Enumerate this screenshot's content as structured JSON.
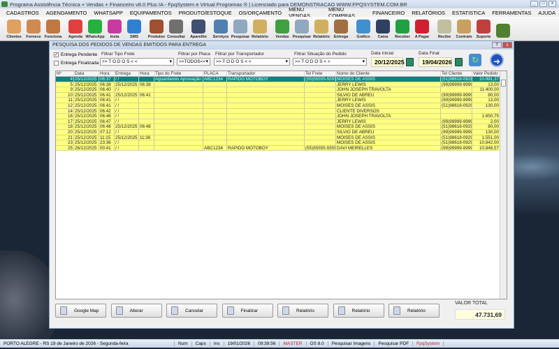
{
  "window": {
    "title": "Programa Assistência Técnica + Vendas + Financeiro v8.0 Plus IA - FpqSystem e Virtual Programas ® | Licenciado para  DEMONSTRACAO WWW.FPQSYSTEM.COM.BR"
  },
  "menu": [
    "CADASTROS",
    "AGENDAMENTO",
    "WHATSAPP",
    "EQUIPAMENTOS",
    "PRODUTO/ESTOQUE",
    "OS/ORÇAMENTO",
    "MENU VENDAS",
    "MENU COMPRAS",
    "FINANCEIRO",
    "RELATÓRIOS",
    "ESTATISTICA",
    "FERRAMENTAS",
    "AJUDA"
  ],
  "toolbar": [
    {
      "label": "Clientes",
      "color": "#e0a060"
    },
    {
      "label": "Fornece",
      "color": "#d08a50"
    },
    {
      "label": "Funciona",
      "color": "#c07840"
    },
    {
      "sep": true
    },
    {
      "label": "Agenda",
      "color": "#e04040"
    },
    {
      "label": "WhatsApp",
      "color": "#25b040"
    },
    {
      "label": "Insta",
      "color": "#c83aa0"
    },
    {
      "label": "SMS",
      "color": "#2f80d0"
    },
    {
      "sep": true
    },
    {
      "label": "Produtos",
      "color": "#a05030"
    },
    {
      "label": "Consultar",
      "color": "#707070"
    },
    {
      "sep": true
    },
    {
      "label": "Aparelho",
      "color": "#405070"
    },
    {
      "sep": true
    },
    {
      "label": "Serviços",
      "color": "#5080b0"
    },
    {
      "label": "Pesquisar",
      "color": "#90a8c0"
    },
    {
      "label": "Relatório",
      "color": "#d0b060"
    },
    {
      "sep": true
    },
    {
      "label": "Vendas",
      "color": "#40a040"
    },
    {
      "label": "Pesquisar",
      "color": "#90a8c0"
    },
    {
      "label": "Relatório",
      "color": "#d0b060"
    },
    {
      "label": "Entrega",
      "color": "#a07040"
    },
    {
      "sep": true
    },
    {
      "label": "Gráfico",
      "color": "#4090d0"
    },
    {
      "label": "Caixa",
      "color": "#304060"
    },
    {
      "label": "Receber",
      "color": "#20a040"
    },
    {
      "label": "A Pagar",
      "color": "#d02030"
    },
    {
      "sep": true
    },
    {
      "label": "Recibo",
      "color": "#c0c0a0"
    },
    {
      "label": "Contrato",
      "color": "#c8a060"
    },
    {
      "label": "Suporte",
      "color": "#c04040"
    },
    {
      "label": "",
      "color": "#508030"
    }
  ],
  "dialog": {
    "title": "PESQUISA DOS PEDIDOS DE VENDAS EMITIDOS PARA ENTREGA",
    "chk_pendente": "Entrega Pendente",
    "chk_finalizada": "Entrega Finalizada",
    "f_tipo_label": "Filtrar Tipo Frete",
    "f_tipo": ">> T O D O S < <",
    "f_placa_label": "Filtrar por Placa",
    "f_placa": ">>TODOS<<",
    "f_transp_label": "Filtrar por Transportador",
    "f_transp": ">> T O D O S < <",
    "f_sit_label": "Filtrar Situação do Pedido",
    "f_sit": ">> T O D O S < <",
    "d_ini_label": "Data Inicial",
    "d_ini": "20/12/2025",
    "d_fim_label": "Data Final",
    "d_fim": "19/04/2026",
    "columns": [
      "Nº",
      "Data",
      "Hora",
      "Entrega",
      "Hora",
      "Tipo do Frete",
      "PLACA",
      "Transportador",
      "Tel Frete",
      "Nome do Cliente",
      "Tel Cliente",
      "Valor Pedido"
    ],
    "rows": [
      [
        "4",
        "25/12/2025",
        "06:37",
        " / /",
        "",
        "Aguardando Aprovação",
        "ABC1234",
        "RAPIDO MOTOBOY",
        "(55)55555-5555",
        "MOISES DE ASSIS",
        "(51)98618-0929",
        "10.991,37"
      ],
      [
        "5",
        "25/12/2025",
        "06:38",
        "25/12/2025",
        "06:38",
        "",
        "",
        "",
        "",
        "JERRY LEWIS",
        "(99)99999-9999",
        "13,00"
      ],
      [
        "9",
        "25/12/2025",
        "06:40",
        " / /",
        "",
        "",
        "",
        "",
        "",
        "JOHN JOSEPH TRAVOLTA",
        "",
        "11.400,00"
      ],
      [
        "10",
        "25/12/2025",
        "06:41",
        "25/12/2025",
        "06:41",
        "",
        "",
        "",
        "",
        "SILVIO DE ABREU",
        "(99)99999-9999",
        "80,00"
      ],
      [
        "11",
        "25/12/2025",
        "06:41",
        " / /",
        "",
        "",
        "",
        "",
        "",
        "JERRY LEWIS",
        "(99)99999-9999",
        "13,00"
      ],
      [
        "12",
        "25/12/2025",
        "06:41",
        " / /",
        "",
        "",
        "",
        "",
        "",
        "MOISES DE ASSIS",
        "(51)98618-0929",
        "130,00"
      ],
      [
        "14",
        "25/12/2025",
        "06:42",
        " / /",
        "",
        "",
        "",
        "",
        "",
        "CLIENTE DIVERSOS",
        "",
        ""
      ],
      [
        "16",
        "25/12/2025",
        "06:46",
        " / /",
        "",
        "",
        "",
        "",
        "",
        "JOHN JOSEPH TRAVOLTA",
        "",
        "1.650,75"
      ],
      [
        "17",
        "25/12/2025",
        "06:47",
        " / /",
        "",
        "",
        "",
        "",
        "",
        "JERRY LEWIS",
        "(99)99999-9999",
        "2,00"
      ],
      [
        "18",
        "25/12/2025",
        "06:48",
        "25/12/2025",
        "06:48",
        "",
        "",
        "",
        "",
        "MOISES DE ASSIS",
        "(51)98618-0929",
        "80,00"
      ],
      [
        "20",
        "25/12/2025",
        "07:12",
        " / /",
        "",
        "",
        "",
        "",
        "",
        "SILVIO DE ABREU",
        "(99)99999-9999",
        "130,00"
      ],
      [
        "21",
        "25/12/2025",
        "11:15",
        "25/12/2025",
        "11:36",
        "",
        "",
        "",
        "",
        "MOISES DE ASSIS",
        "(51)98618-0929",
        "1.551,00"
      ],
      [
        "23",
        "25/12/2025",
        "23:36",
        " / /",
        "",
        "",
        "",
        "",
        "",
        "MOISES DE ASSIS",
        "(51)98618-0929",
        "10.842,00"
      ],
      [
        "25",
        "26/12/2025",
        "00:41",
        " / /",
        "",
        "",
        "ABC1234",
        "RAPIDO MOTOBOY",
        "(55)55555-5555",
        "DAVI MEIRELLES",
        "(99)99999-9999",
        "10.848,57"
      ]
    ],
    "buttons": [
      "Google Map",
      "Alterar",
      "Cancelar",
      "Finalizar",
      "Relatório",
      "Relatório",
      "Relatório"
    ],
    "total_label": "VALOR TOTAL",
    "total": "47.731,69"
  },
  "status": [
    "PORTO ALEGRE - RS 19 de Janeiro de 2026 - Segunda-feira",
    "Num",
    "Caps",
    "Ins",
    "19/01/2026",
    "09:39:56",
    "MASTER",
    "OS 8.0",
    "Pesquisar Imagens",
    "Pesquisar PDF",
    "FpqSystem"
  ]
}
